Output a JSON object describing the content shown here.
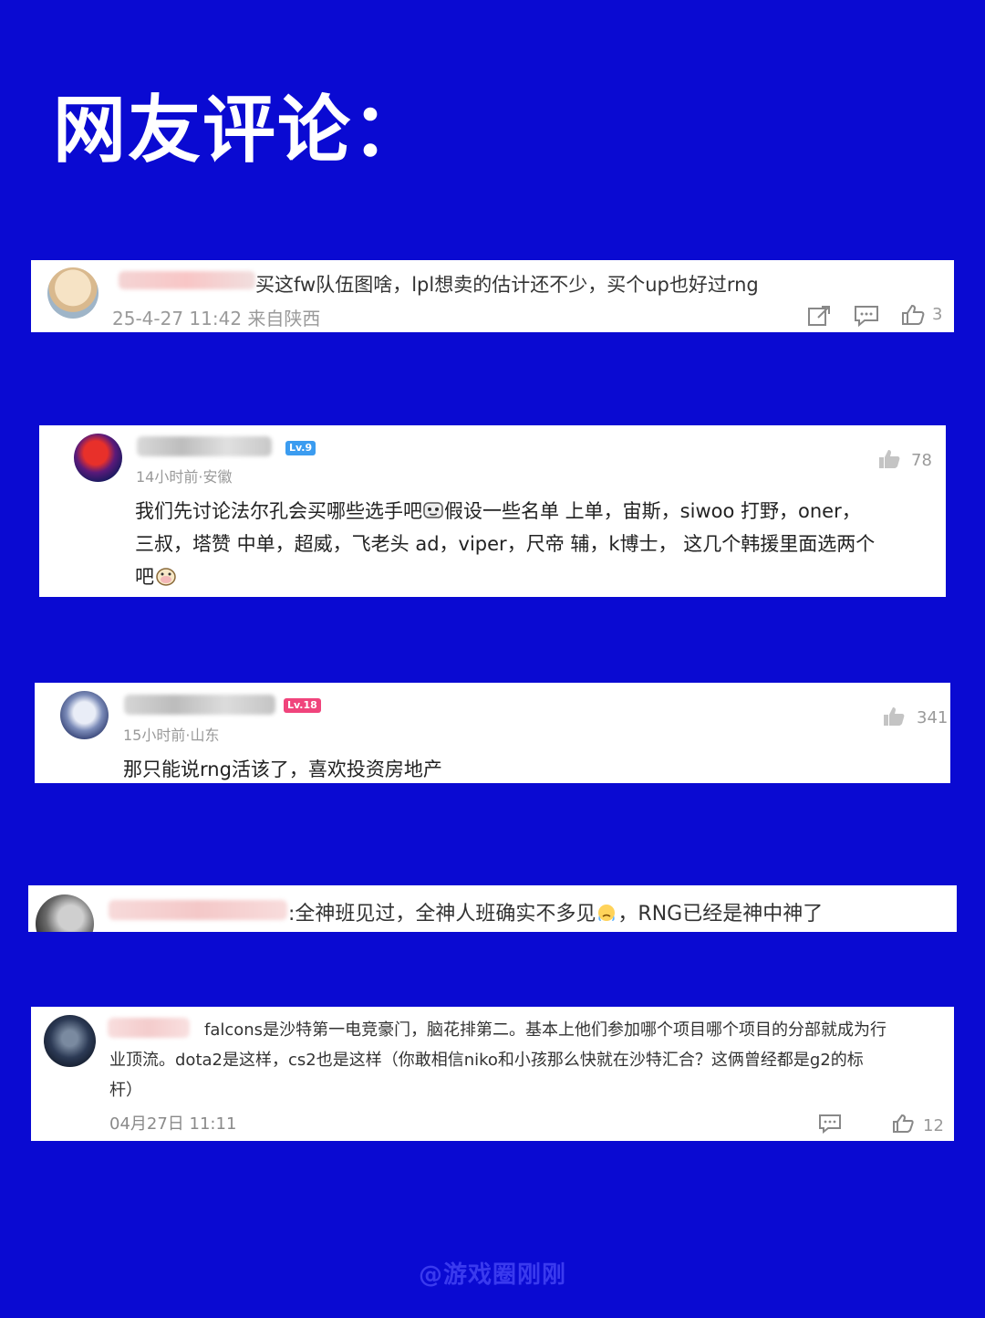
{
  "title": "网友评论：",
  "comments": [
    {
      "text": "买这fw队伍图啥，lpl想卖的估计还不少，买个up也好过rng",
      "meta": "25-4-27 11:42 来自陕西",
      "likes": "3",
      "icons": [
        "share-icon",
        "comment-icon",
        "like-icon"
      ]
    },
    {
      "badge": "Lv.9",
      "meta": "14小时前·安徽",
      "likes": "78",
      "line1": "我们先讨论法尔孔会买哪些选手吧",
      "line1b": "假设一些名单 上单，宙斯，siwoo 打野，oner，",
      "line2": "三叔，塔赞 中单，超威，飞老头 ad，viper，尺帝 辅，k博士， 这几个韩援里面选两个",
      "line3": "吧",
      "icons": [
        "like-icon"
      ]
    },
    {
      "badge": "Lv.18",
      "meta": "15小时前·山东",
      "likes": "341",
      "text": "那只能说rng活该了，喜欢投资房地产",
      "icons": [
        "like-icon"
      ]
    },
    {
      "text": ":全神班见过，全神人班确实不多见",
      "text2": "，RNG已经是神中神了"
    },
    {
      "line1": "falcons是沙特第一电竞豪门，脑花排第二。基本上他们参加哪个项目哪个项目的分部就成为行",
      "line2": "业顶流。dota2是这样，cs2也是这样（你敢相信niko和小孩那么快就在沙特汇合？这俩曾经都是g2的标",
      "line3": "杆）",
      "meta": "04月27日 11:11",
      "likes": "12",
      "icons": [
        "comment-icon",
        "like-icon"
      ]
    }
  ],
  "watermark": "@游戏圈刚刚",
  "colors": {
    "background": "#0a0ad2",
    "card": "#ffffff",
    "lv9_badge": "#3b9cf0",
    "lv18_badge": "#f0447c"
  }
}
